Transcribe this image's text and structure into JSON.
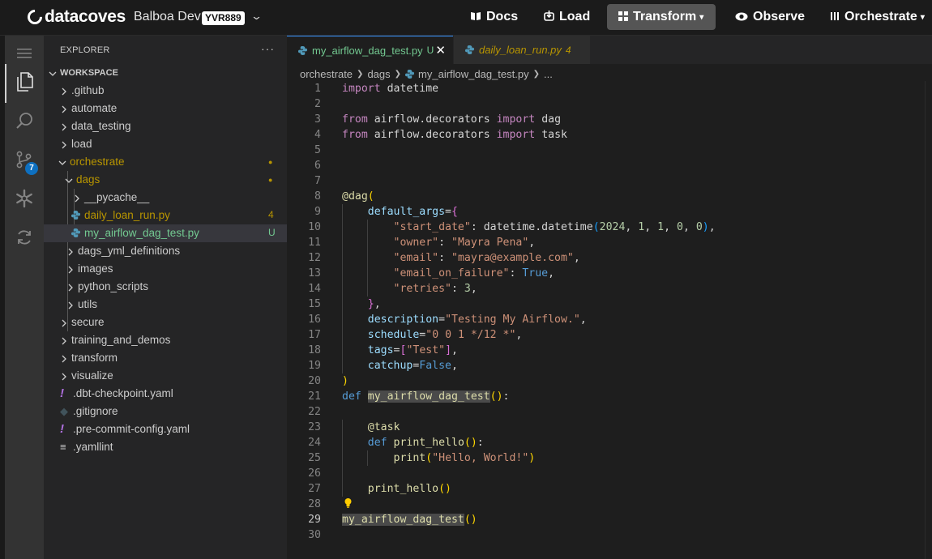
{
  "brand": {
    "name": "datacoves"
  },
  "environment": {
    "name": "Balboa Dev",
    "badge": "YVR889"
  },
  "nav": {
    "docs": "Docs",
    "load": "Load",
    "transform": "Transform",
    "observe": "Observe",
    "orchestrate": "Orchestrate"
  },
  "activity": {
    "scm_badge": "7"
  },
  "explorer": {
    "title": "EXPLORER",
    "more": "···",
    "workspace": "WORKSPACE",
    "items": [
      {
        "label": ".github",
        "kind": "folder"
      },
      {
        "label": "automate",
        "kind": "folder"
      },
      {
        "label": "data_testing",
        "kind": "folder"
      },
      {
        "label": "load",
        "kind": "folder"
      },
      {
        "label": "orchestrate",
        "kind": "folder-open",
        "status": "modified"
      },
      {
        "label": "dags",
        "kind": "folder-open",
        "status": "modified"
      },
      {
        "label": "__pycache__",
        "kind": "folder"
      },
      {
        "label": "daily_loan_run.py",
        "kind": "python",
        "badge": "4"
      },
      {
        "label": "my_airflow_dag_test.py",
        "kind": "python",
        "badge": "U"
      },
      {
        "label": "dags_yml_definitions",
        "kind": "folder"
      },
      {
        "label": "images",
        "kind": "folder"
      },
      {
        "label": "python_scripts",
        "kind": "folder"
      },
      {
        "label": "utils",
        "kind": "folder"
      },
      {
        "label": "secure",
        "kind": "folder"
      },
      {
        "label": "training_and_demos",
        "kind": "folder"
      },
      {
        "label": "transform",
        "kind": "folder"
      },
      {
        "label": "visualize",
        "kind": "folder"
      },
      {
        "label": ".dbt-checkpoint.yaml",
        "kind": "yaml"
      },
      {
        "label": ".gitignore",
        "kind": "git"
      },
      {
        "label": ".pre-commit-config.yaml",
        "kind": "yaml"
      },
      {
        "label": ".yamllint",
        "kind": "lines"
      }
    ]
  },
  "tabs": [
    {
      "label": "my_airflow_dag_test.py",
      "status": "U",
      "close": "✕"
    },
    {
      "label": "daily_loan_run.py",
      "status": "4"
    }
  ],
  "breadcrumb": [
    "orchestrate",
    "dags",
    "my_airflow_dag_test.py",
    "..."
  ],
  "code": {
    "import": "import",
    "from": "from",
    "import_kw": "import",
    "datetime": "datetime",
    "module": "airflow.decorators",
    "dag": "dag",
    "task": "task",
    "at_dag": "@dag",
    "default_args": "default_args",
    "k_start_date": "\"start_date\"",
    "k_owner": "\"owner\"",
    "k_email": "\"email\"",
    "k_email_on_failure": "\"email_on_failure\"",
    "k_retries": "\"retries\"",
    "datetime_call": "datetime.datetime",
    "date_args": [
      "2024",
      "1",
      "1",
      "0",
      "0"
    ],
    "v_owner": "\"Mayra Pena\"",
    "v_email": "\"mayra@example.com\"",
    "v_true": "True",
    "v_retries": "3",
    "description": "description",
    "v_description": "\"Testing My Airflow.\"",
    "schedule": "schedule",
    "v_schedule": "\"0 0 1 */12 *\"",
    "tags": "tags",
    "v_tag": "\"Test\"",
    "catchup": "catchup",
    "v_false": "False",
    "def": "def",
    "func_name": "my_airflow_dag_test",
    "at_task": "@task",
    "print_hello": "print_hello",
    "print": "print",
    "v_hello": "\"Hello, World!\"",
    "call_name": "my_airflow_dag_test",
    "line_numbers": [
      "1",
      "2",
      "3",
      "4",
      "5",
      "6",
      "7",
      "8",
      "9",
      "10",
      "11",
      "12",
      "13",
      "14",
      "15",
      "16",
      "17",
      "18",
      "19",
      "20",
      "21",
      "22",
      "23",
      "24",
      "25",
      "26",
      "27",
      "28",
      "29",
      "30"
    ]
  },
  "colors": {
    "accent": "#3794ff",
    "modified": "#b89500",
    "untracked": "#73c991",
    "python_icon": "#519aba"
  }
}
